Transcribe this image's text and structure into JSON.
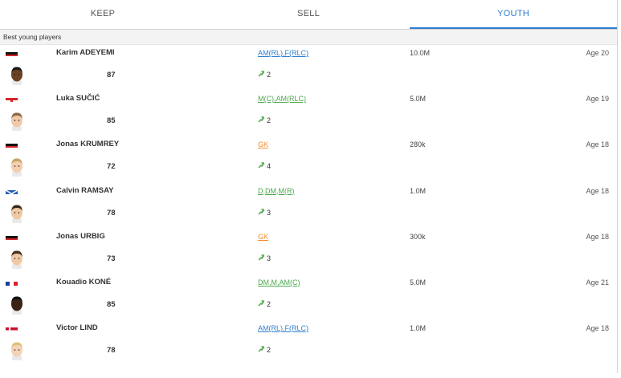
{
  "tabs": [
    {
      "label": "KEEP",
      "active": false
    },
    {
      "label": "SELL",
      "active": false
    },
    {
      "label": "YOUTH",
      "active": true
    }
  ],
  "accent_color": "#2f7fd0",
  "section_title": "Best young players",
  "players": [
    {
      "name": "Karim ADEYEMI",
      "flag": "germany-flag",
      "rating": "87",
      "positions": "AM(RL),F(RLC)",
      "pos_color": "blue",
      "growth": "2",
      "value": "10.0M",
      "age": "Age 20",
      "skin": "#6b4226",
      "hair": "#1a1a1a"
    },
    {
      "name": "Luka SUČIĆ",
      "flag": "croatia-flag",
      "rating": "85",
      "positions": "M(C),AM(RLC)",
      "pos_color": "green",
      "growth": "2",
      "value": "5.0M",
      "age": "Age 19",
      "skin": "#f0c9a8",
      "hair": "#8a6a4a"
    },
    {
      "name": "Jonas KRUMREY",
      "flag": "germany-flag",
      "rating": "72",
      "positions": "GK",
      "pos_color": "orange",
      "growth": "4",
      "value": "280k",
      "age": "Age 18",
      "skin": "#f2cfb0",
      "hair": "#c9a56a"
    },
    {
      "name": "Calvin RAMSAY",
      "flag": "scotland-flag",
      "rating": "78",
      "positions": "D,DM,M(R)",
      "pos_color": "green",
      "growth": "3",
      "value": "1.0M",
      "age": "Age 18",
      "skin": "#efc9a6",
      "hair": "#3a2a1a"
    },
    {
      "name": "Jonas URBIG",
      "flag": "germany-flag",
      "rating": "73",
      "positions": "GK",
      "pos_color": "orange",
      "growth": "3",
      "value": "300k",
      "age": "Age 18",
      "skin": "#efc9a6",
      "hair": "#4a3320"
    },
    {
      "name": "Kouadio KONÉ",
      "flag": "france-flag",
      "rating": "85",
      "positions": "DM,M,AM(C)",
      "pos_color": "green",
      "growth": "2",
      "value": "5.0M",
      "age": "Age 21",
      "skin": "#3b2416",
      "hair": "#111111"
    },
    {
      "name": "Victor LIND",
      "flag": "denmark-flag",
      "rating": "78",
      "positions": "AM(RL),F(RLC)",
      "pos_color": "blue",
      "growth": "2",
      "value": "1.0M",
      "age": "Age 18",
      "skin": "#f3d3b8",
      "hair": "#e0c07a"
    }
  ]
}
